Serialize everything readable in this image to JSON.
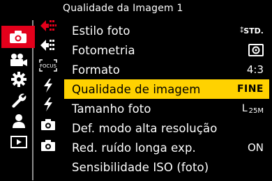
{
  "header": {
    "title": "Qualidade da Imagem 1"
  },
  "main_tabs": [
    {
      "icon": "camera-icon",
      "active": true
    },
    {
      "icon": "video-camera-icon",
      "active": false
    },
    {
      "icon": "gear-icon",
      "active": false
    },
    {
      "icon": "wrench-icon",
      "active": false
    },
    {
      "icon": "person-icon",
      "active": false
    },
    {
      "icon": "playback-icon",
      "active": false
    }
  ],
  "sub_tabs": [
    {
      "icon": "image-quality-icon",
      "active": true
    },
    {
      "icon": "image-quality-2-icon",
      "active": false
    },
    {
      "icon": "focus-icon",
      "label": "FOCUS",
      "active": false
    },
    {
      "icon": "flash-icon",
      "active": false
    },
    {
      "icon": "flash-2-icon",
      "active": false
    },
    {
      "icon": "camera-small-icon",
      "active": false
    },
    {
      "icon": "camera-small-2-icon",
      "active": false
    }
  ],
  "menu": {
    "items": [
      {
        "label": "Estilo foto",
        "value": "STD.",
        "value_prefix": "⁑"
      },
      {
        "label": "Fotometria",
        "value": "",
        "value_icon": "metering-icon"
      },
      {
        "label": "Formato",
        "value": "4:3"
      },
      {
        "label": "Qualidade de imagem",
        "value": "FINE",
        "selected": true
      },
      {
        "label": "Tamanho foto",
        "value": "L",
        "value_sub": "25M"
      },
      {
        "label": "Def. modo alta resolução",
        "value": ""
      },
      {
        "label": "Red. ruído longa exp.",
        "value": "ON"
      },
      {
        "label": "Sensibilidade ISO (foto)",
        "value": ""
      }
    ]
  },
  "colors": {
    "accent_tab": "#e3001b",
    "selection": "#ffd200",
    "background": "#000000"
  }
}
